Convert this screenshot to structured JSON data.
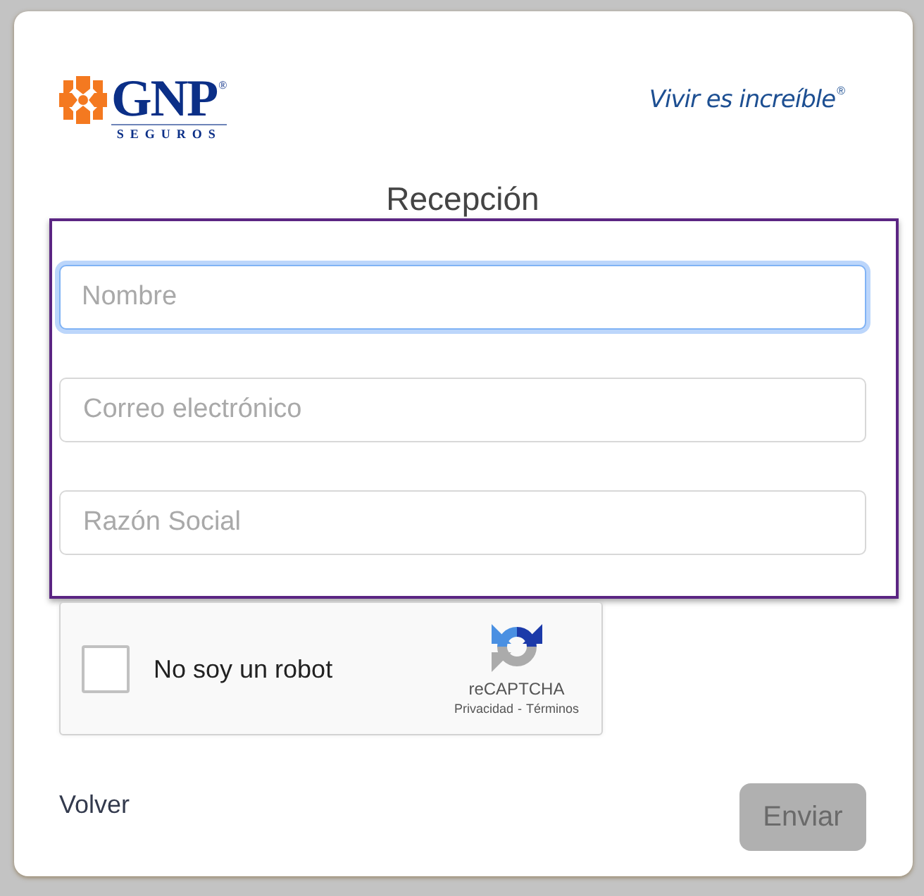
{
  "logo": {
    "brand": "GNP",
    "registered": "®",
    "subtitle": "SEGUROS"
  },
  "tagline": {
    "text": "Vivir es increíble",
    "registered": "®"
  },
  "title": "Recepción",
  "form": {
    "fields": [
      {
        "placeholder": "Nombre",
        "focused": true
      },
      {
        "placeholder": "Correo electrónico",
        "focused": false
      },
      {
        "placeholder": "Razón Social",
        "focused": false
      }
    ]
  },
  "captcha": {
    "label": "No soy un robot",
    "checked": false,
    "brand": "reCAPTCHA",
    "links": [
      {
        "label": "Privacidad"
      },
      {
        "label": "Términos"
      }
    ],
    "separator": "-"
  },
  "actions": {
    "back": {
      "label": "Volver"
    },
    "submit": {
      "label": "Enviar",
      "disabled": true
    }
  }
}
